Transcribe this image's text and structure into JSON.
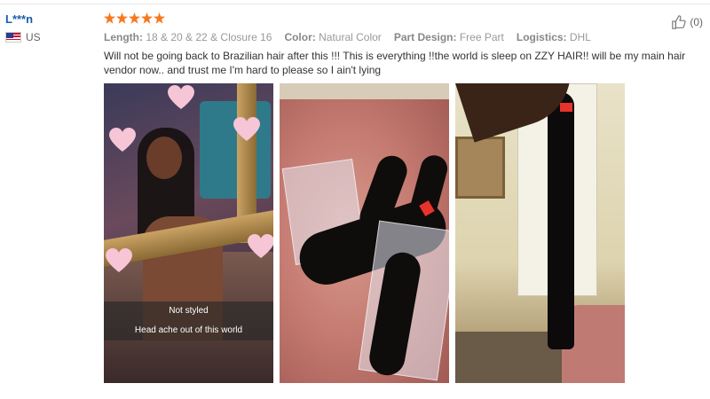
{
  "buyer": {
    "name": "L***n",
    "country": "US"
  },
  "review": {
    "rating": 5,
    "rating_max": 5,
    "star_color": "#f57a1f",
    "attributes": [
      {
        "label": "Length:",
        "value": "18 & 20 & 22 & Closure 16"
      },
      {
        "label": "Color:",
        "value": "Natural Color"
      },
      {
        "label": "Part Design:",
        "value": "Free Part"
      },
      {
        "label": "Logistics:",
        "value": "DHL"
      }
    ],
    "text": "Will not be going back to Brazilian hair after this !!! This is everything !!the world is sleep on ZZY HAIR!! will be my main hair vendor now.. and trust me I'm hard to please so I ain't lying"
  },
  "helpful": {
    "count": "(0)",
    "icon": "thumbs-up-icon"
  },
  "photos": [
    {
      "caption_1": "Not styled",
      "caption_2": "Head ache out of this world"
    },
    {},
    {}
  ],
  "colors": {
    "buyer_name": "#1a5ea8",
    "label": "#888888",
    "value": "#999999"
  }
}
